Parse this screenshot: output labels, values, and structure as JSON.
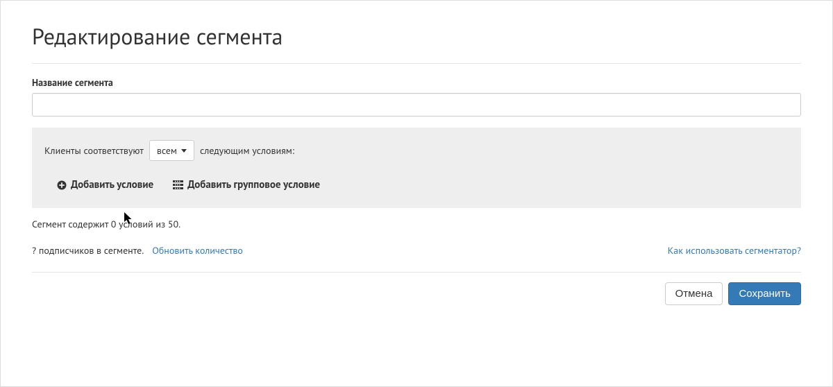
{
  "page": {
    "title": "Редактирование сегмента"
  },
  "form": {
    "name_label": "Название сегмента",
    "name_value": ""
  },
  "conditions": {
    "prefix": "Клиенты соответствуют",
    "mode_selected": "всем",
    "suffix": "следующим условиям:",
    "add_condition": "Добавить условие",
    "add_group_condition": "Добавить групповое условие"
  },
  "info": {
    "count_line": "Сегмент содержит 0 условий из 50.",
    "subscribers": "? подписчиков в сегменте.",
    "refresh": "Обновить количество",
    "help": "Как использовать сегментатор?"
  },
  "footer": {
    "cancel": "Отмена",
    "save": "Сохранить"
  }
}
